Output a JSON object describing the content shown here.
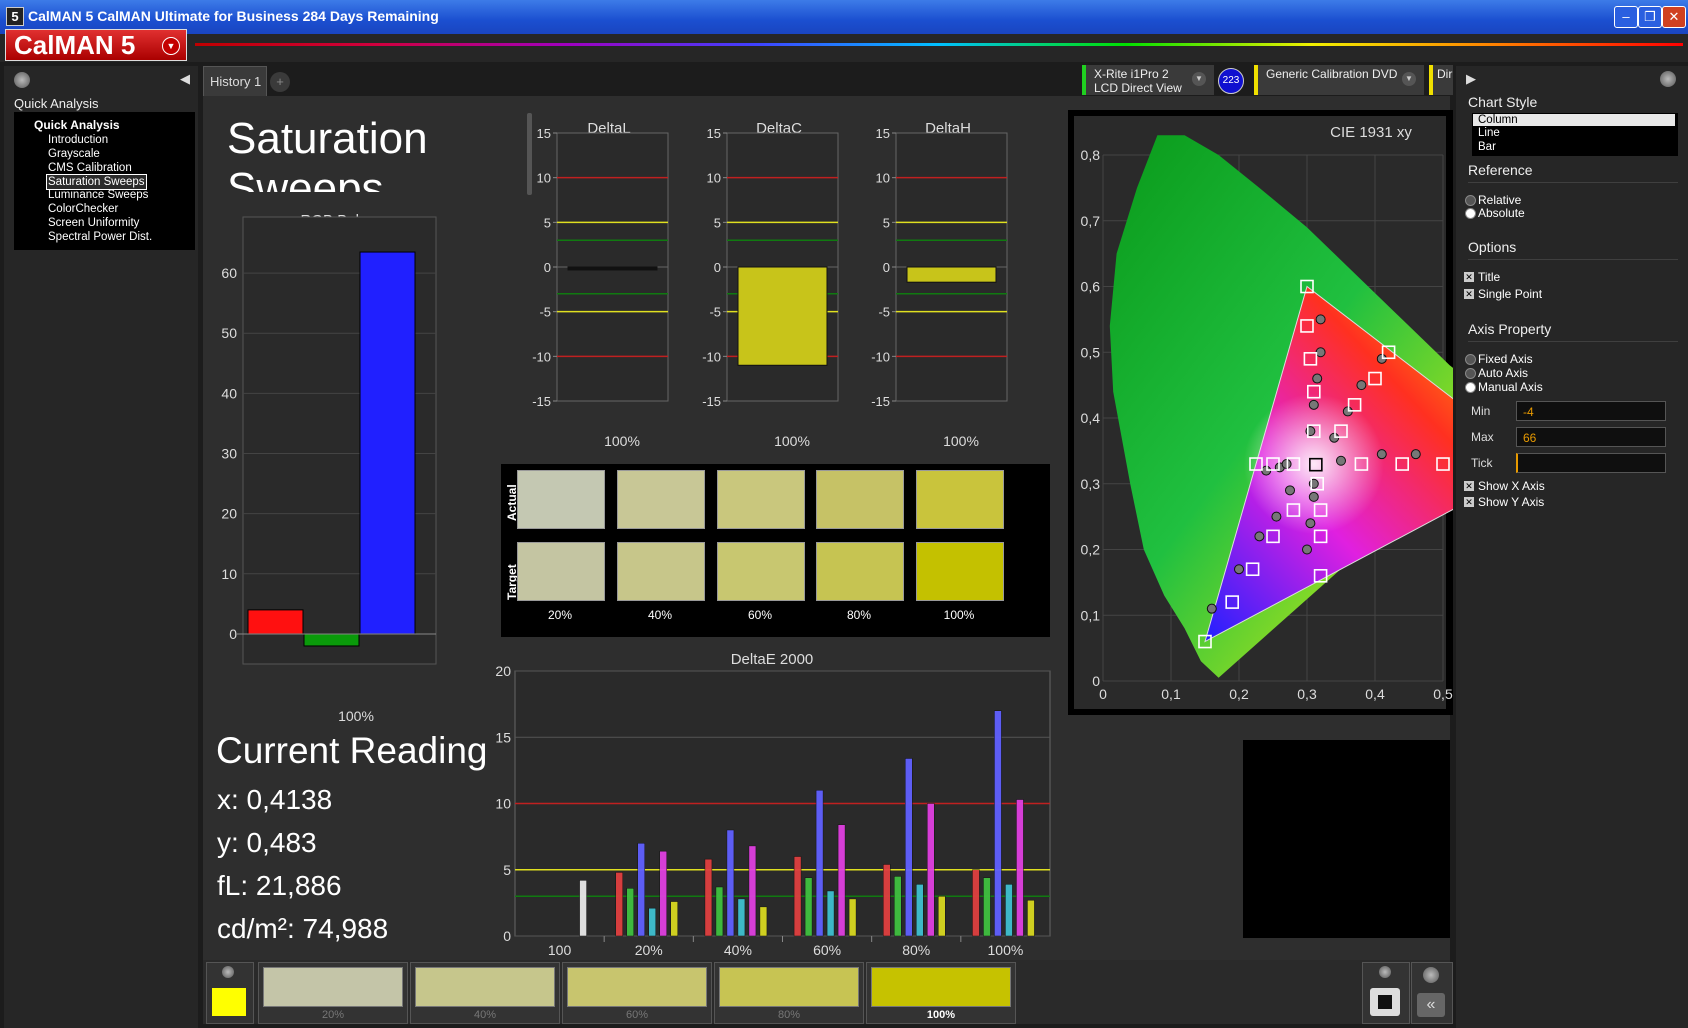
{
  "titlebar": {
    "title": "CalMAN 5 CalMAN Ultimate for Business 284 Days Remaining",
    "logo": "5"
  },
  "brand": {
    "name": "CalMAN 5"
  },
  "nav": {
    "header": "Quick Analysis",
    "root": "Quick Analysis",
    "items": [
      "Introduction",
      "Grayscale",
      "CMS Calibration",
      "Saturation Sweeps",
      "Luminance Sweeps",
      "ColorChecker",
      "Screen Uniformity",
      "Spectral Power Dist."
    ],
    "selected": "Saturation Sweeps"
  },
  "tabs": {
    "active": "History 1",
    "add": "+"
  },
  "devices": {
    "meter_line1": "X-Rite i1Pro 2",
    "meter_line2": "LCD Direct View",
    "meter_badge": "223",
    "source": "Generic Calibration DVD",
    "third": "Dir"
  },
  "page": {
    "title": "Saturation Sweeps"
  },
  "rgb_balance": {
    "title": "RGB Balance",
    "xlabel": "100%"
  },
  "delta_l": {
    "title": "DeltaL",
    "xlabel": "100%"
  },
  "delta_c": {
    "title": "DeltaC",
    "xlabel": "100%"
  },
  "delta_h": {
    "title": "DeltaH",
    "xlabel": "100%"
  },
  "swatch_rows": {
    "actual": "Actual",
    "target": "Target"
  },
  "swatch_labels": [
    "20%",
    "40%",
    "60%",
    "80%",
    "100%"
  ],
  "swatch_colors": {
    "actual": [
      "#c4c8b2",
      "#c8c796",
      "#c9c77d",
      "#c6c266",
      "#c9c43c"
    ],
    "target": [
      "#c4c5a2",
      "#c7c68a",
      "#c8c770",
      "#c6c452",
      "#c4c100"
    ]
  },
  "deltae": {
    "title": "DeltaE 2000"
  },
  "cie": {
    "title": "CIE 1931 xy"
  },
  "reading": {
    "title": "Current Reading",
    "x": "x: 0,4138",
    "y": "y: 0,483",
    "fl": "fL: 21,886",
    "cdm2": "cd/m²: 74,988"
  },
  "bottom": {
    "current_color": "#ffff00",
    "swatches": [
      "20%",
      "40%",
      "60%",
      "80%",
      "100%"
    ],
    "swatch_colors": [
      "#c4c5a8",
      "#c6c68c",
      "#c8c56e",
      "#c7c453",
      "#c6c200"
    ]
  },
  "right_panel": {
    "chart_style": "Chart Style",
    "styles": [
      "Column",
      "Line",
      "Bar"
    ],
    "selected_style": "Column",
    "reference": "Reference",
    "reference_opts": [
      "Relative",
      "Absolute"
    ],
    "reference_selected": "Absolute",
    "options": "Options",
    "option_items": [
      "Title",
      "Single Point"
    ],
    "axis_property": "Axis Property",
    "axis_opts": [
      "Fixed Axis",
      "Auto Axis",
      "Manual Axis"
    ],
    "axis_selected": "Manual Axis",
    "min_label": "Min",
    "min_value": "-4",
    "max_label": "Max",
    "max_value": "66",
    "tick_label": "Tick",
    "tick_value": "",
    "show_x": "Show X Axis",
    "show_y": "Show Y Axis"
  },
  "chart_data": [
    {
      "type": "bar",
      "title": "RGB Balance",
      "categories": [
        "100%"
      ],
      "series": [
        {
          "name": "Red",
          "values": [
            4
          ]
        },
        {
          "name": "Green",
          "values": [
            -2
          ]
        },
        {
          "name": "Blue",
          "values": [
            63.5
          ]
        }
      ],
      "ylim": [
        -4,
        66
      ],
      "yticks": [
        0,
        10,
        20,
        30,
        40,
        50,
        60
      ],
      "colors": {
        "Red": "#ff1010",
        "Green": "#0a9a0a",
        "Blue": "#2020ff"
      }
    },
    {
      "type": "bar",
      "title": "DeltaL",
      "categories": [
        "100%"
      ],
      "values": [
        -0.2
      ],
      "ylim": [
        -15,
        15
      ],
      "yticks": [
        15,
        10,
        5,
        0,
        -5,
        -10,
        -15
      ],
      "thresholds": [
        {
          "value": 10,
          "color": "#c02020"
        },
        {
          "value": 5,
          "color": "#e0e020"
        },
        {
          "value": 3,
          "color": "#107a10"
        },
        {
          "value": -3,
          "color": "#107a10"
        },
        {
          "value": -5,
          "color": "#e0e020"
        },
        {
          "value": -10,
          "color": "#c02020"
        }
      ]
    },
    {
      "type": "bar",
      "title": "DeltaC",
      "categories": [
        "100%"
      ],
      "values": [
        -11
      ],
      "ylim": [
        -15,
        15
      ],
      "yticks": [
        15,
        10,
        5,
        0,
        -5,
        -10,
        -15
      ],
      "thresholds": [
        {
          "value": 10,
          "color": "#c02020"
        },
        {
          "value": 5,
          "color": "#e0e020"
        },
        {
          "value": 3,
          "color": "#107a10"
        },
        {
          "value": -3,
          "color": "#107a10"
        },
        {
          "value": -5,
          "color": "#e0e020"
        },
        {
          "value": -10,
          "color": "#c02020"
        }
      ]
    },
    {
      "type": "bar",
      "title": "DeltaH",
      "categories": [
        "100%"
      ],
      "values": [
        -1.7
      ],
      "ylim": [
        -15,
        15
      ],
      "yticks": [
        15,
        10,
        5,
        0,
        -5,
        -10,
        -15
      ],
      "thresholds": [
        {
          "value": 10,
          "color": "#c02020"
        },
        {
          "value": 5,
          "color": "#e0e020"
        },
        {
          "value": 3,
          "color": "#107a10"
        },
        {
          "value": -3,
          "color": "#107a10"
        },
        {
          "value": -5,
          "color": "#e0e020"
        },
        {
          "value": -10,
          "color": "#c02020"
        }
      ]
    },
    {
      "type": "bar",
      "title": "DeltaE 2000",
      "categories": [
        "100",
        "20%",
        "40%",
        "60%",
        "80%",
        "100%"
      ],
      "ylim": [
        0,
        20
      ],
      "yticks": [
        0,
        5,
        10,
        15,
        20
      ],
      "thresholds": [
        {
          "value": 10,
          "color": "#c02020"
        },
        {
          "value": 5,
          "color": "#e0e020"
        },
        {
          "value": 3,
          "color": "#107a10"
        }
      ],
      "series": [
        {
          "name": "White",
          "color": "#e8e8e8",
          "values": [
            4.2,
            null,
            null,
            null,
            null,
            null
          ]
        },
        {
          "name": "Red",
          "color": "#e04040",
          "values": [
            null,
            4.8,
            5.8,
            6.0,
            5.4,
            5.0
          ]
        },
        {
          "name": "Green",
          "color": "#40c040",
          "values": [
            null,
            3.6,
            3.7,
            4.4,
            4.5,
            4.4
          ]
        },
        {
          "name": "Blue",
          "color": "#6060ff",
          "values": [
            null,
            7.0,
            8.0,
            11.0,
            13.4,
            17.0
          ]
        },
        {
          "name": "Cyan",
          "color": "#40c0d0",
          "values": [
            null,
            2.1,
            2.8,
            3.4,
            3.9,
            3.9
          ]
        },
        {
          "name": "Magenta",
          "color": "#e040e0",
          "values": [
            null,
            6.4,
            6.8,
            8.4,
            10.0,
            10.3
          ]
        },
        {
          "name": "Yellow",
          "color": "#d8d820",
          "values": [
            null,
            2.6,
            2.2,
            2.8,
            3.0,
            2.7
          ]
        }
      ]
    },
    {
      "type": "scatter",
      "title": "CIE 1931 xy",
      "xlim": [
        0,
        0.5
      ],
      "ylim": [
        0,
        0.8
      ],
      "xticks": [
        "0",
        "0,1",
        "0,2",
        "0,3",
        "0,4",
        "0,5"
      ],
      "yticks": [
        "0",
        "0,1",
        "0,2",
        "0,3",
        "0,4",
        "0,5",
        "0,6",
        "0,7",
        "0,8"
      ],
      "gamut_triangle": [
        [
          0.64,
          0.33
        ],
        [
          0.3,
          0.6
        ],
        [
          0.15,
          0.06
        ]
      ],
      "targets": [
        [
          0.15,
          0.06
        ],
        [
          0.19,
          0.12
        ],
        [
          0.22,
          0.17
        ],
        [
          0.25,
          0.22
        ],
        [
          0.28,
          0.26
        ],
        [
          0.3,
          0.6
        ],
        [
          0.3,
          0.54
        ],
        [
          0.305,
          0.49
        ],
        [
          0.31,
          0.44
        ],
        [
          0.31,
          0.38
        ],
        [
          0.32,
          0.16
        ],
        [
          0.32,
          0.22
        ],
        [
          0.32,
          0.26
        ],
        [
          0.315,
          0.3
        ],
        [
          0.225,
          0.33
        ],
        [
          0.25,
          0.33
        ],
        [
          0.28,
          0.33
        ],
        [
          0.38,
          0.33
        ],
        [
          0.44,
          0.33
        ],
        [
          0.5,
          0.33
        ],
        [
          0.42,
          0.5
        ],
        [
          0.4,
          0.46
        ],
        [
          0.37,
          0.42
        ],
        [
          0.35,
          0.38
        ]
      ],
      "measured": [
        [
          0.16,
          0.11
        ],
        [
          0.2,
          0.17
        ],
        [
          0.23,
          0.22
        ],
        [
          0.255,
          0.25
        ],
        [
          0.275,
          0.29
        ],
        [
          0.32,
          0.55
        ],
        [
          0.32,
          0.5
        ],
        [
          0.315,
          0.46
        ],
        [
          0.31,
          0.42
        ],
        [
          0.305,
          0.38
        ],
        [
          0.3,
          0.2
        ],
        [
          0.305,
          0.24
        ],
        [
          0.31,
          0.28
        ],
        [
          0.31,
          0.3
        ],
        [
          0.24,
          0.32
        ],
        [
          0.26,
          0.325
        ],
        [
          0.27,
          0.33
        ],
        [
          0.35,
          0.335
        ],
        [
          0.41,
          0.345
        ],
        [
          0.46,
          0.345
        ],
        [
          0.41,
          0.49
        ],
        [
          0.38,
          0.45
        ],
        [
          0.36,
          0.41
        ],
        [
          0.34,
          0.37
        ]
      ]
    }
  ]
}
